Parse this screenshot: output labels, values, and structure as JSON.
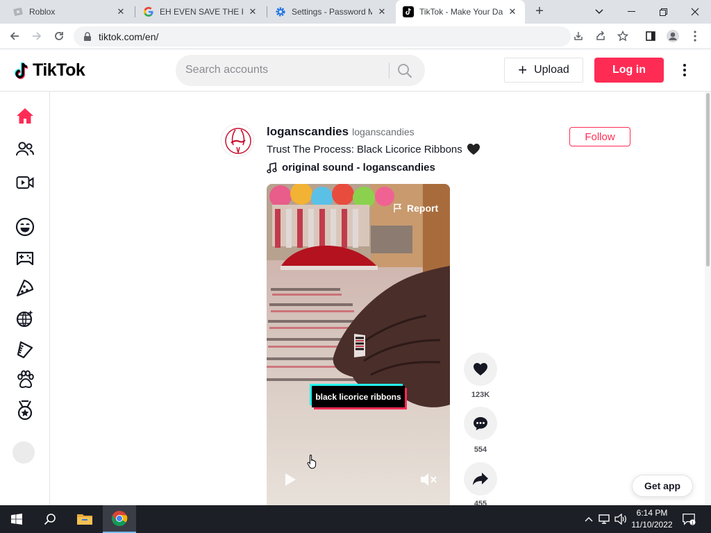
{
  "browser": {
    "tabs": [
      {
        "title": "Roblox",
        "icon": "roblox-icon",
        "active": false
      },
      {
        "title": "EH EVEN SAVE THE PAS",
        "icon": "google-icon",
        "active": false
      },
      {
        "title": "Settings - Password Ma",
        "icon": "settings-gear-icon",
        "active": false
      },
      {
        "title": "TikTok - Make Your Da",
        "icon": "tiktok-icon",
        "active": true
      }
    ],
    "url": "tiktok.com/en/"
  },
  "header": {
    "logo_text": "TikTok",
    "search_placeholder": "Search accounts",
    "upload_label": "Upload",
    "login_label": "Log in"
  },
  "sidebar": {
    "items": [
      {
        "icon": "home-icon",
        "active": true
      },
      {
        "icon": "following-icon",
        "active": false
      },
      {
        "icon": "live-icon",
        "active": false
      },
      {
        "icon": "comedy-icon",
        "active": false
      },
      {
        "icon": "gaming-icon",
        "active": false
      },
      {
        "icon": "food-icon",
        "active": false
      },
      {
        "icon": "dance-icon",
        "active": false
      },
      {
        "icon": "beauty-icon",
        "active": false
      },
      {
        "icon": "animals-icon",
        "active": false
      },
      {
        "icon": "sports-icon",
        "active": false
      }
    ]
  },
  "post": {
    "author": "loganscandies",
    "nickname": "loganscandies",
    "caption": "Trust The Process: Black Licorice Ribbons",
    "music": "original sound - loganscandies",
    "follow_label": "Follow",
    "report_label": "Report",
    "video_overlay_text": "black licorice ribbons",
    "likes": "123K",
    "comments": "554",
    "shares": "455"
  },
  "get_app_label": "Get app",
  "taskbar": {
    "time": "6:14 PM",
    "date": "11/10/2022"
  },
  "colors": {
    "tiktok_red": "#fe2c55",
    "tiktok_cyan": "#25f4ee",
    "taskbar": "#1d1f26"
  }
}
